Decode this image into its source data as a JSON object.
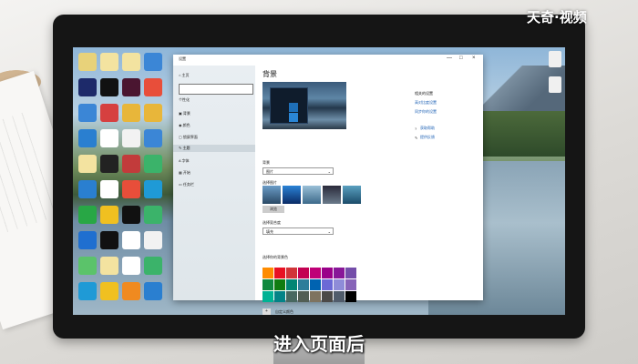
{
  "settings": {
    "window_title": "设置",
    "controls": {
      "minimize": "—",
      "maximize": "□",
      "close": "×"
    },
    "nav": {
      "home": "主页",
      "search_placeholder": "",
      "section": "个性化",
      "items": [
        "背景",
        "颜色",
        "锁屏界面",
        "主题",
        "字体",
        "开始",
        "任务栏"
      ],
      "selected": "主题"
    },
    "page_title": "背景",
    "background_label": "背景",
    "background_value": "图片",
    "choose_picture_label": "选择图片",
    "browse_label": "浏览",
    "fit_label": "选择契合度",
    "fit_value": "填充",
    "color_label": "选择你的背景色",
    "custom_color_label": "自定义颜色",
    "related_heading": "相关的设置",
    "related_links": [
      "高对比度设置",
      "同步你的设置"
    ],
    "help_links": [
      "获取帮助",
      "提供反馈"
    ]
  },
  "swatch_colors": [
    "#ff8c00",
    "#e81123",
    "#d13438",
    "#c30052",
    "#bf0077",
    "#9a0089",
    "#881798",
    "#744da9",
    "#10893e",
    "#107c10",
    "#018574",
    "#2d7d9a",
    "#0063b1",
    "#6b69d6",
    "#8e8cd8",
    "#8764b8",
    "#00b294",
    "#038387",
    "#486860",
    "#525e54",
    "#7e735f",
    "#4c4a48",
    "#515c6b",
    "#000000"
  ],
  "watermark": "天奇·视频",
  "subtitle": "进入页面后",
  "icon_names": [
    "window-preview-icon",
    "search-icon",
    "home-icon",
    "palette-icon",
    "lock-icon",
    "theme-icon",
    "font-icon",
    "start-icon",
    "taskbar-icon"
  ]
}
